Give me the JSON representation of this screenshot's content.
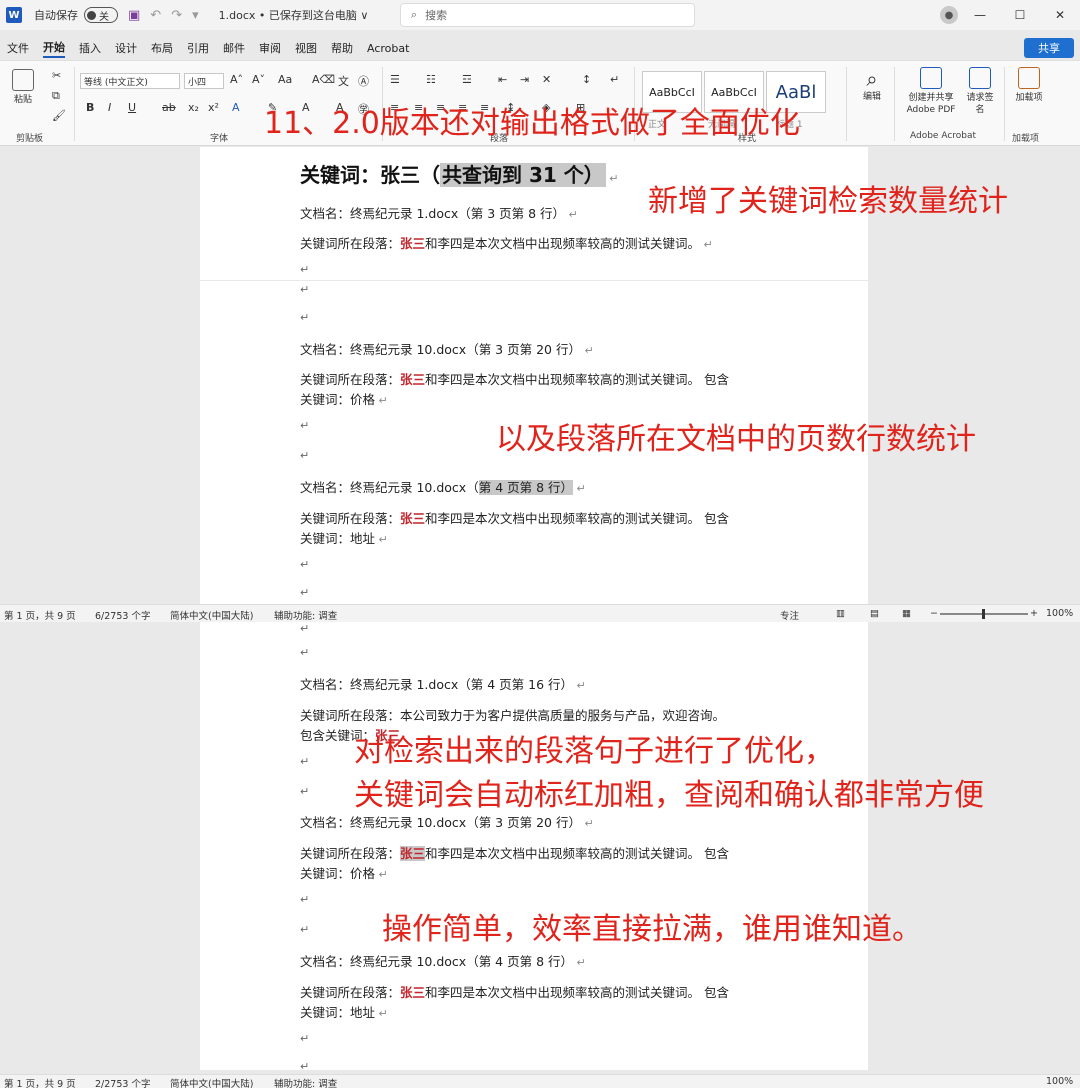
{
  "titlebar": {
    "app_logo": "W",
    "autosave_label": "自动保存",
    "autosave_state": "关",
    "doc_title": "1.docx • 已保存到这台电脑 ∨",
    "search_placeholder": "搜索",
    "window_controls": [
      "—",
      "☐",
      "✕"
    ]
  },
  "menu": {
    "tabs": [
      "文件",
      "开始",
      "插入",
      "设计",
      "布局",
      "引用",
      "邮件",
      "审阅",
      "视图",
      "帮助",
      "Acrobat"
    ],
    "active_tab": "开始",
    "share_label": "共享"
  },
  "ribbon": {
    "paste_label": "粘贴",
    "clipboard_group": "剪贴板",
    "font_name": "等线 (中文正文)",
    "font_size": "小四",
    "font_group": "字体",
    "paragraph_group": "段落",
    "styles": [
      "AaBbCcI",
      "AaBbCcI",
      "AaBl"
    ],
    "style_names": [
      "正文",
      "无间隔",
      "标题 1"
    ],
    "styles_group": "样式",
    "edit_label": "编辑",
    "create_pdf_label": "创建并共享 Adobe PDF",
    "request_sign_label": "请求签名",
    "acrobat_group": "Adobe Acrobat",
    "addins_label": "加载项",
    "addins_group": "加载项"
  },
  "pane1": {
    "heading_prefix": "关键词：张三（",
    "heading_highlight": "共查询到 31 个）",
    "line1": "文档名：终焉纪元录 1.docx（第 3 页第 8 行）",
    "line2_prefix": "关键词所在段落：",
    "keyword": "张三",
    "line2_suffix": "和李四是本次文档中出现频率较高的测试关键词。"
  },
  "pane2": {
    "line1": "文档名：终焉纪元录 10.docx（第 3 页第 20 行）",
    "line2_prefix": "关键词所在段落：",
    "keyword": "张三",
    "line2_suffix": "和李四是本次文档中出现频率较高的测试关键词。 包含",
    "line3": "关键词：价格",
    "line4_prefix": "文档名：终焉纪元录 10.docx（",
    "line4_highlight": "第 4 页第 8 行）",
    "line5_prefix": "关键词所在段落：",
    "line5_suffix": "和李四是本次文档中出现频率较高的测试关键词。 包含",
    "line6": "关键词：地址"
  },
  "status1": {
    "page": "第 1 页，共 9 页",
    "words": "6/2753 个字",
    "lang": "简体中文(中国大陆)",
    "a11y": "辅助功能: 调查",
    "focus": "专注",
    "zoom": "100%"
  },
  "pane3": {
    "line1": "文档名：终焉纪元录 1.docx（第 4 页第 16 行）",
    "line2": "关键词所在段落：本公司致力于为客户提供高质量的服务与产品，欢迎咨询。",
    "line3_prefix": "包含关键词：",
    "keyword": "张三",
    "line4": "文档名：终焉纪元录 10.docx（第 3 页第 20 行）",
    "line5_prefix": "关键词所在段落：",
    "line5_suffix": "和李四是本次文档中出现频率较高的测试关键词。 包含",
    "line6": "关键词：价格",
    "line7": "文档名：终焉纪元录 10.docx（第 4 页第 8 行）",
    "line8_suffix": "和李四是本次文档中出现频率较高的测试关键词。 包含",
    "line9": "关键词：地址"
  },
  "status2": {
    "page": "第 1 页，共 9 页",
    "words": "2/2753 个字",
    "lang": "简体中文(中国大陆)",
    "a11y": "辅助功能: 调查",
    "zoom": "100%"
  },
  "notes": {
    "n1": "11、2.0版本还对输出格式做了全面优化",
    "n2": "新增了关键词检索数量统计",
    "n3": "以及段落所在文档中的页数行数统计",
    "n4": "对检索出来的段落句子进行了优化，",
    "n5": "关键词会自动标红加粗，查阅和确认都非常方便",
    "n6": "操作简单，效率直接拉满，谁用谁知道。"
  },
  "colors": {
    "accent": "#1f5bbd",
    "keyword": "#c0262c",
    "annotation": "#e0231b"
  },
  "icons": [
    "word-logo-icon",
    "save-icon",
    "undo-icon",
    "redo-icon",
    "search-icon",
    "paste-icon",
    "edit-icon",
    "pdf-icon",
    "sign-icon",
    "addins-icon"
  ]
}
